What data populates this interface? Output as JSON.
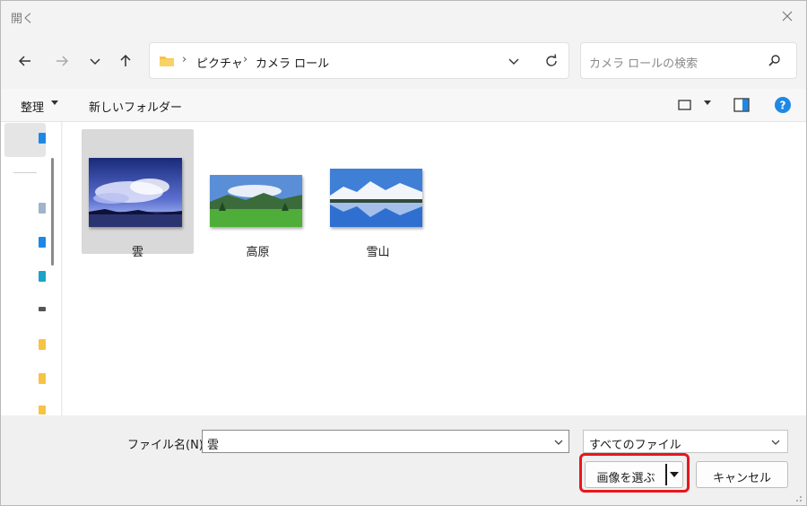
{
  "window": {
    "title": "開く"
  },
  "address": {
    "crumbs": [
      "ピクチャ",
      "カメラ ロール"
    ]
  },
  "search": {
    "placeholder": "カメラ ロールの検索"
  },
  "toolbar": {
    "organize_label": "整理",
    "new_folder_label": "新しいフォルダー"
  },
  "files": [
    {
      "name": "雲",
      "selected": true
    },
    {
      "name": "高原",
      "selected": false
    },
    {
      "name": "雪山",
      "selected": false
    }
  ],
  "footer": {
    "filename_label": "ファイル名(N):",
    "filename_value": "雲",
    "filetype_value": "すべてのファイル",
    "open_label": "画像を選ぶ",
    "cancel_label": "キャンセル"
  },
  "colors": {
    "highlight": "#e8161c",
    "help": "#1e88e5",
    "folder": "#f6c343"
  }
}
